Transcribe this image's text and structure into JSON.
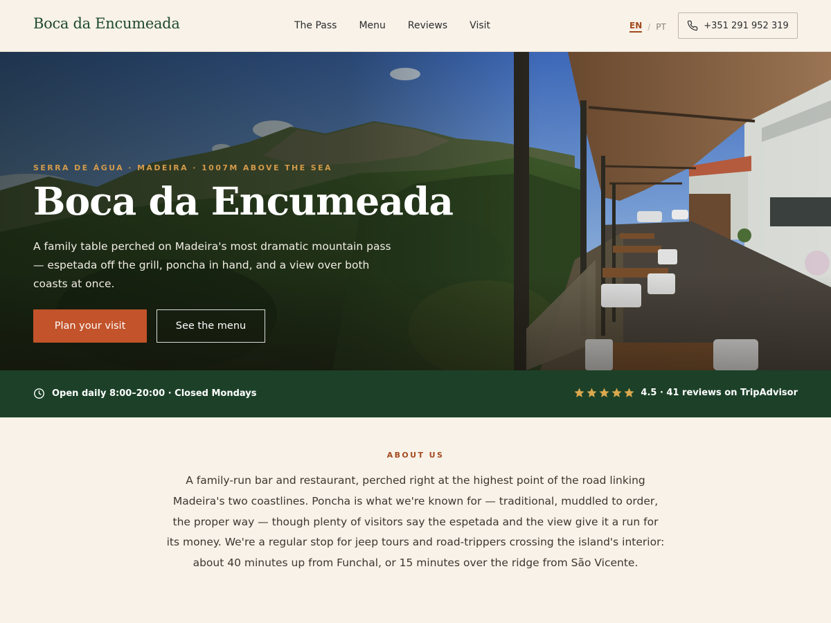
{
  "header": {
    "logo": "Boca da Encumeada",
    "nav": [
      "The Pass",
      "Menu",
      "Reviews",
      "Visit"
    ],
    "lang": {
      "active": "EN",
      "separator": "/",
      "other": "PT"
    },
    "phone": "+351 291 952 319",
    "phone_icon": "phone-icon"
  },
  "hero": {
    "eyebrow": "SERRA DE ÁGUA · MADEIRA · 1007M ABOVE THE SEA",
    "title": "Boca da Encumeada",
    "description": "A family table perched on Madeira's most dramatic mountain pass — espetada off the grill, poncha in hand, and a view over both coasts at once.",
    "primary_button": "Plan your visit",
    "secondary_button": "See the menu"
  },
  "infobar": {
    "hours": "Open daily 8:00–20:00 · Closed Mondays",
    "hours_icon": "clock-icon",
    "rating_value": 4.5,
    "rating_max": 5,
    "rating_text": "4.5 · 41 reviews on TripAdvisor"
  },
  "about": {
    "label": "ABOUT US",
    "text": "A family-run bar and restaurant, perched right at the highest point of the road linking Madeira's two coastlines. Poncha is what we're known for — traditional, muddled to order, the proper way — though plenty of visitors say the espetada and the view give it a run for its money. We're a regular stop for jeep tours and road-trippers crossing the island's interior: about 40 minutes up from Funchal, or 15 minutes over the ridge from São Vicente."
  },
  "colors": {
    "brand_green": "#1c4128",
    "accent": "#c2532a",
    "eyebrow": "#d39a4a",
    "star": "#d9a84e",
    "background": "#f8f2e9"
  }
}
